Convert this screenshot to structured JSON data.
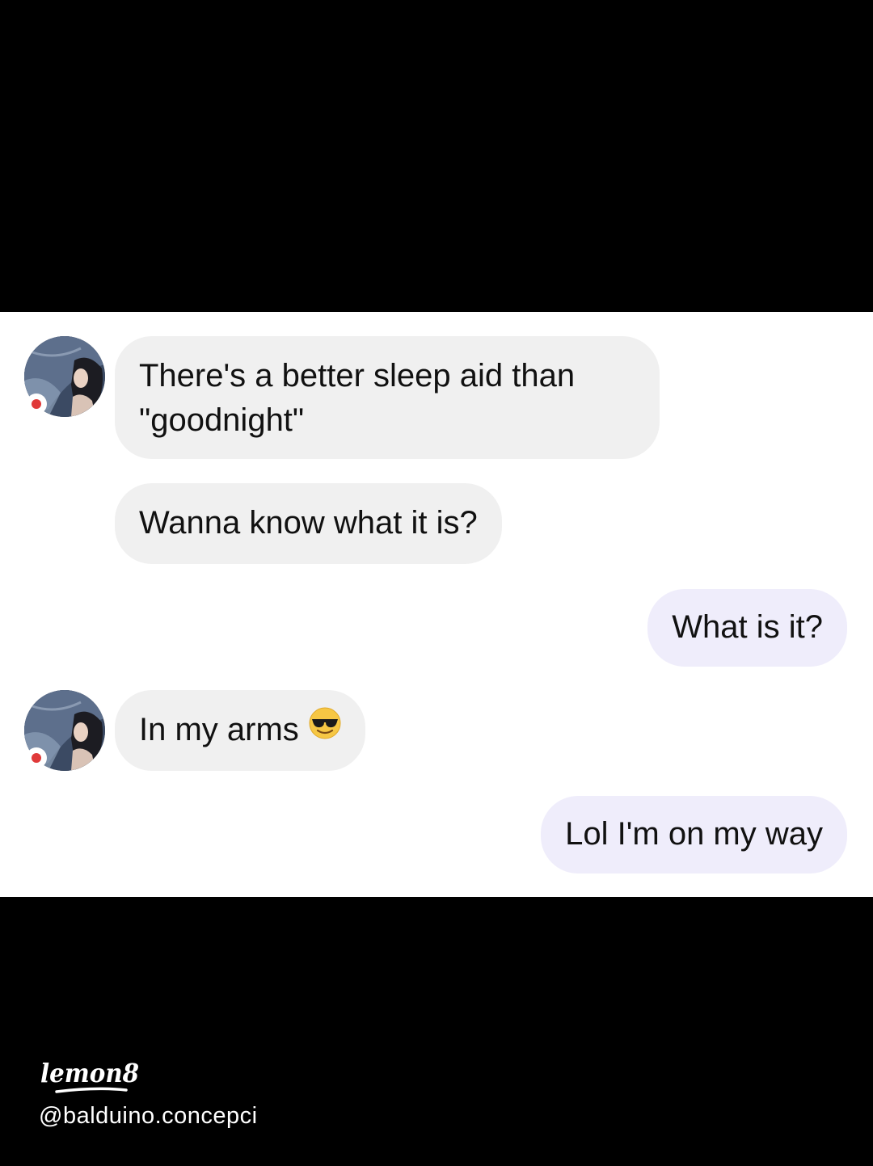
{
  "conversation": {
    "messages": [
      {
        "sender": "them",
        "text": "There's a better sleep aid than \"goodnight\""
      },
      {
        "sender": "them",
        "text": "Wanna know what it is?"
      },
      {
        "sender": "me",
        "text": "What is it?"
      },
      {
        "sender": "them",
        "text": "In my arms",
        "emoji": "sunglasses-smiling-face"
      },
      {
        "sender": "me",
        "text": "Lol I'm on my way"
      }
    ],
    "contact_online": true
  },
  "watermark": {
    "brand": "Lemon8",
    "handle": "@balduino.concepci"
  },
  "colors": {
    "incoming_bubble": "#f0f0f0",
    "outgoing_bubble": "#efedfb",
    "status_dot": "#e03a3a",
    "background": "#000000"
  }
}
